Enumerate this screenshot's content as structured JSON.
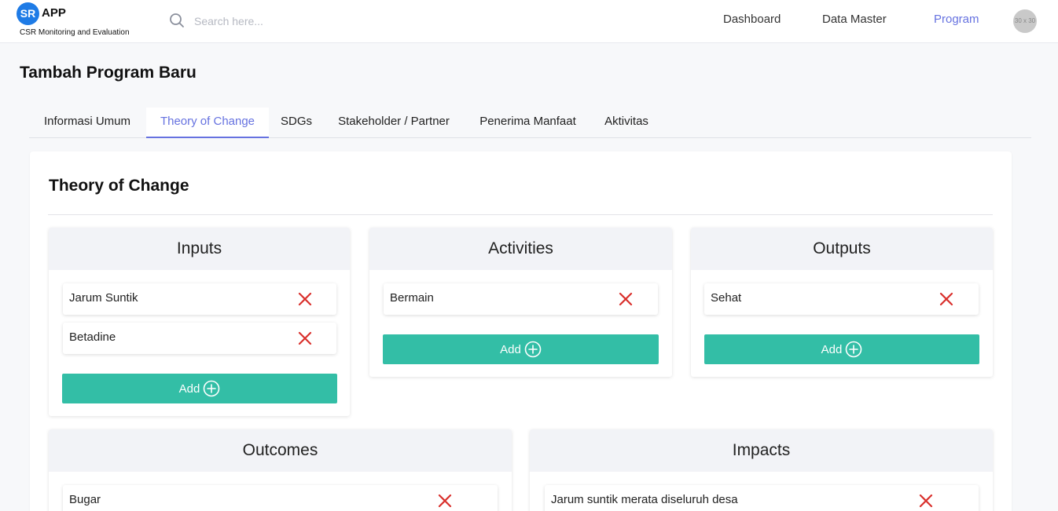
{
  "navbar": {
    "logo_mark": "SR",
    "logo_name": "APP",
    "logo_subtitle": "CSR Monitoring and Evaluation",
    "search_placeholder": "Search here...",
    "links": [
      "Dashboard",
      "Data Master",
      "Program"
    ],
    "active_link": "Program",
    "avatar_text": "30 x 30"
  },
  "page": {
    "title": "Tambah Program Baru"
  },
  "tabs": {
    "items": [
      "Informasi Umum",
      "Theory of Change",
      "SDGs",
      "Stakeholder / Partner",
      "Penerima Manfaat",
      "Aktivitas"
    ],
    "active": "Theory of Change"
  },
  "toc": {
    "title": "Theory of Change",
    "add_label": "Add",
    "inputs": {
      "title": "Inputs",
      "items": [
        "Jarum Suntik",
        "Betadine"
      ]
    },
    "activities": {
      "title": "Activities",
      "items": [
        "Bermain"
      ]
    },
    "outputs": {
      "title": "Outputs",
      "items": [
        "Sehat"
      ]
    },
    "outcomes": {
      "title": "Outcomes",
      "items": [
        "Bugar"
      ]
    },
    "impacts": {
      "title": "Impacts",
      "items": [
        "Jarum suntik merata diseluruh desa"
      ]
    }
  },
  "colors": {
    "accent": "#6672e0",
    "logo_blue": "#1e7be6",
    "add_button": "#33bea6",
    "delete_icon": "#d9302c"
  },
  "icons": {
    "search": "search-icon",
    "delete": "close-icon",
    "add": "plus-circle-icon"
  }
}
